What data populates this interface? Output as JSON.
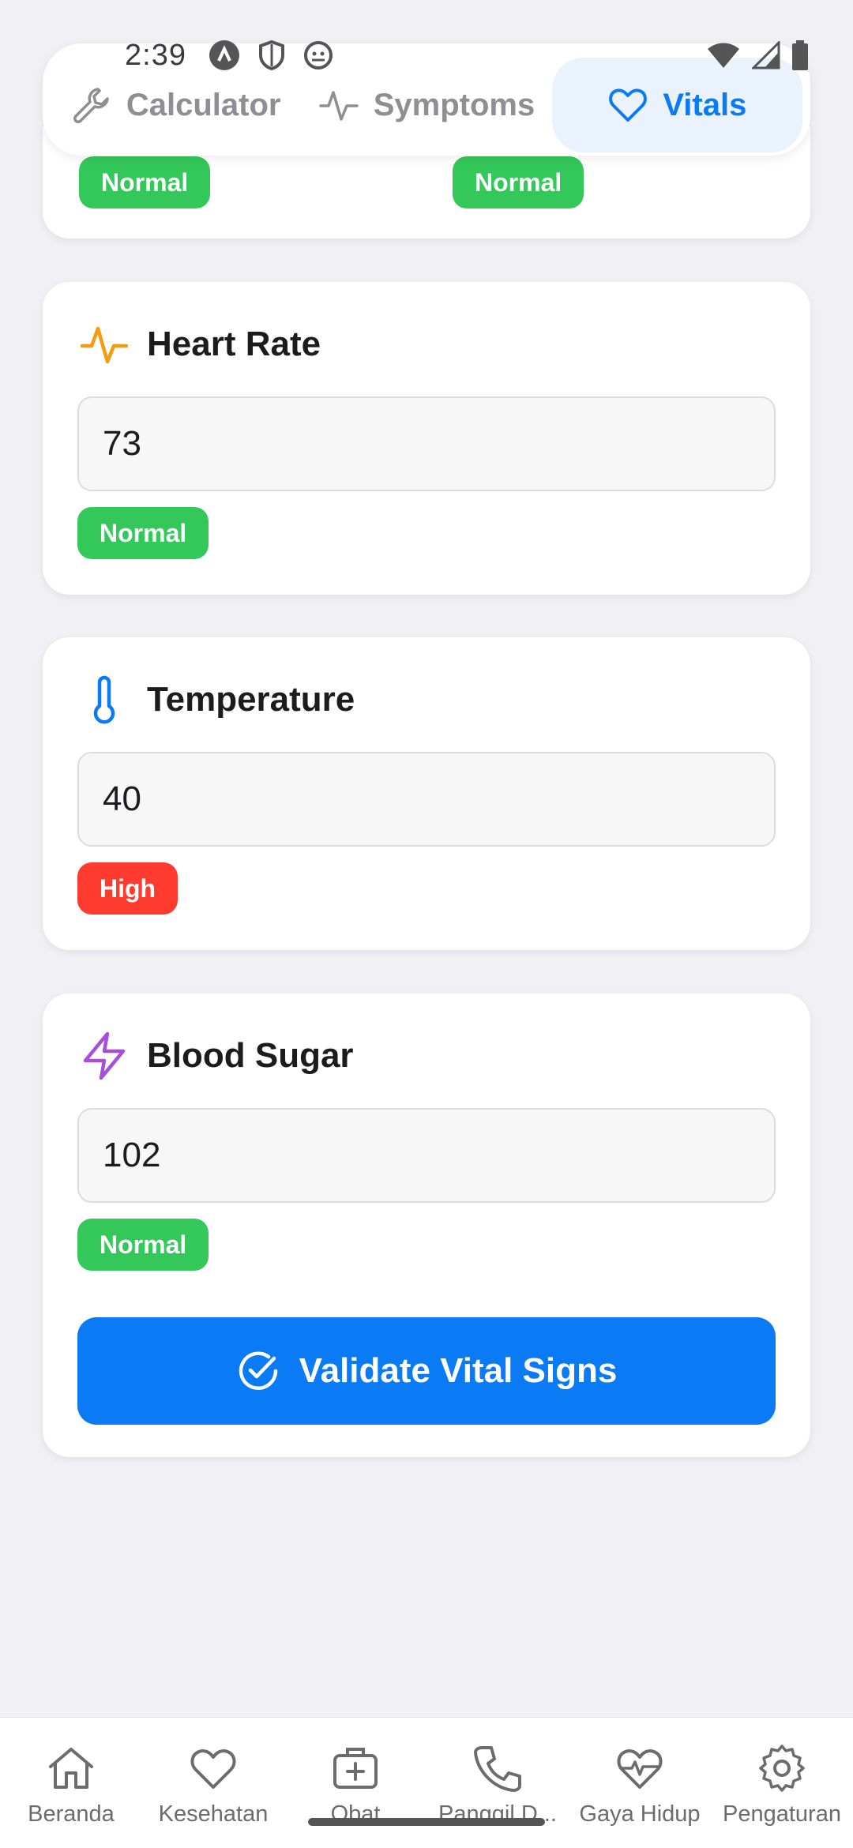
{
  "status_bar": {
    "time": "2:39"
  },
  "tabs": [
    {
      "label": "Calculator",
      "icon": "wrench-icon",
      "active": false
    },
    {
      "label": "Symptoms",
      "icon": "activity-icon",
      "active": false
    },
    {
      "label": "Vitals",
      "icon": "heart-icon",
      "active": true
    }
  ],
  "top_card": {
    "badge_left": "Normal",
    "badge_right": "Normal"
  },
  "vitals": {
    "heart_rate": {
      "title": "Heart Rate",
      "value": "73",
      "status": "Normal",
      "icon": "pulse-icon",
      "icon_color": "#f39c12"
    },
    "temperature": {
      "title": "Temperature",
      "value": "40",
      "status": "High",
      "icon": "thermometer-icon",
      "icon_color": "#0a7bf5"
    },
    "blood_sugar": {
      "title": "Blood Sugar",
      "value": "102",
      "status": "Normal",
      "icon": "lightning-icon",
      "icon_color": "#a550d8"
    }
  },
  "validate_button": {
    "label": "Validate Vital Signs"
  },
  "bottom_nav": [
    {
      "label": "Beranda",
      "icon": "home-icon"
    },
    {
      "label": "Kesehatan",
      "icon": "heart-icon"
    },
    {
      "label": "Obat",
      "icon": "medical-kit-icon"
    },
    {
      "label": "Panggil D...",
      "icon": "phone-icon"
    },
    {
      "label": "Gaya Hidup",
      "icon": "heart-pulse-icon"
    },
    {
      "label": "Pengaturan",
      "icon": "gear-icon"
    }
  ],
  "colors": {
    "accent": "#0a7bf5",
    "normal": "#34c759",
    "high": "#ff3b30"
  }
}
